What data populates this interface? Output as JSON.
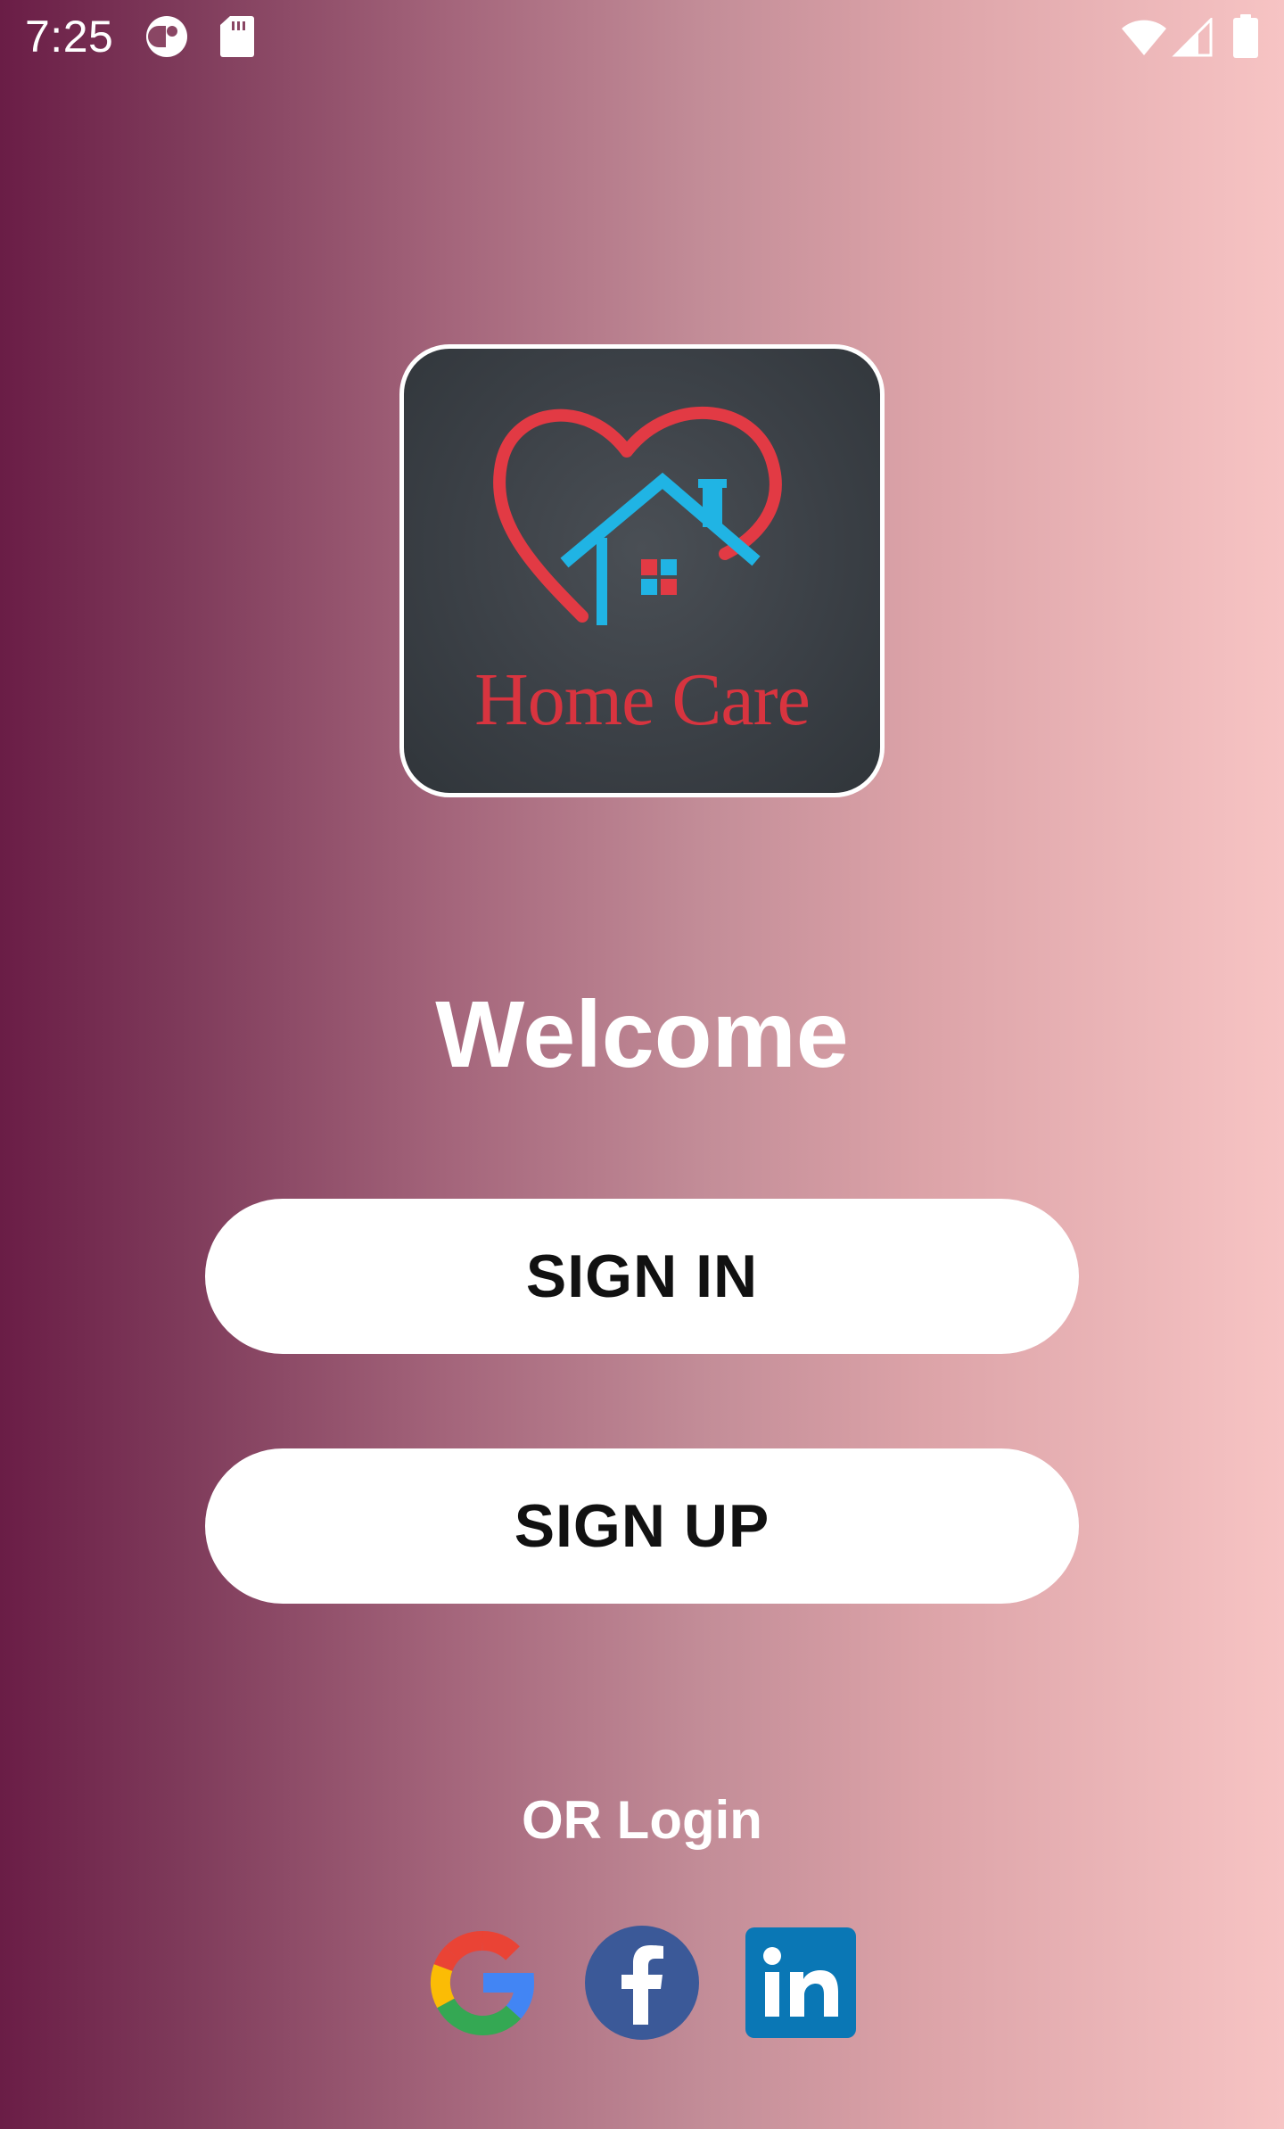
{
  "status_bar": {
    "time": "7:25",
    "icons": [
      "app-notification-icon",
      "sd-card-icon",
      "wifi-icon",
      "cellular-signal-icon",
      "battery-icon"
    ]
  },
  "logo": {
    "text": "Home Care",
    "colors": {
      "heart": "#e23a44",
      "house": "#20b4e4",
      "window_red": "#e23a44",
      "window_blue": "#20b4e4",
      "background": "#3b4046"
    }
  },
  "welcome": {
    "title": "Welcome"
  },
  "buttons": {
    "sign_in": "SIGN IN",
    "sign_up": "SIGN UP"
  },
  "social": {
    "prompt": "OR Login",
    "providers": [
      "google-icon",
      "facebook-icon",
      "linkedin-icon"
    ]
  },
  "theme": {
    "gradient_start": "#6a1d46",
    "gradient_end": "#f7c4c4",
    "button_bg": "#ffffff",
    "facebook": "#3b5998",
    "linkedin": "#0a77b5"
  }
}
